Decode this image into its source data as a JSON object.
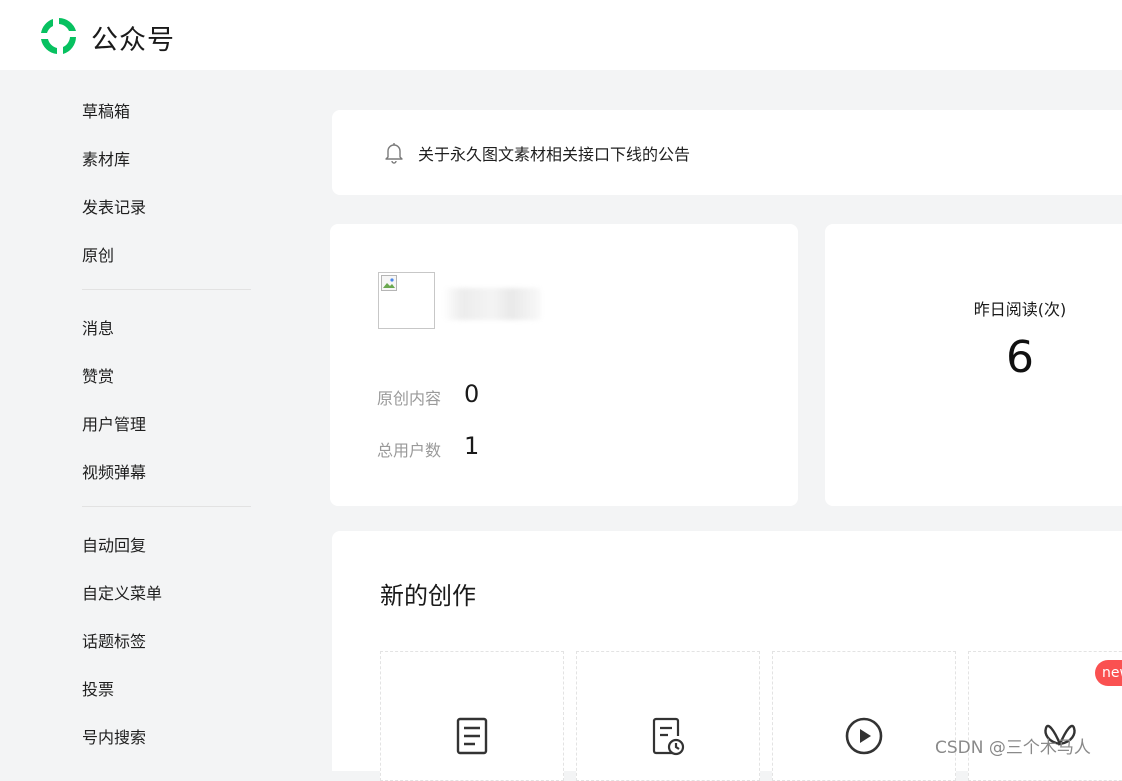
{
  "header": {
    "brand": "公众号",
    "logo_icon": "wechat-mp-logo-icon",
    "accent_color": "#07c160"
  },
  "sidebar": {
    "groups": [
      {
        "items": [
          {
            "label": "草稿箱"
          },
          {
            "label": "素材库"
          },
          {
            "label": "发表记录"
          },
          {
            "label": "原创"
          }
        ]
      },
      {
        "items": [
          {
            "label": "消息"
          },
          {
            "label": "赞赏"
          },
          {
            "label": "用户管理"
          },
          {
            "label": "视频弹幕"
          }
        ]
      },
      {
        "items": [
          {
            "label": "自动回复"
          },
          {
            "label": "自定义菜单"
          },
          {
            "label": "话题标签"
          },
          {
            "label": "投票"
          },
          {
            "label": "号内搜索"
          }
        ]
      }
    ]
  },
  "notice": {
    "icon": "bell-icon",
    "text": "关于永久图文素材相关接口下线的公告"
  },
  "account": {
    "stats": [
      {
        "label": "原创内容",
        "value": "0"
      },
      {
        "label": "总用户数",
        "value": "1"
      }
    ]
  },
  "reads": {
    "label": "昨日阅读(次)",
    "value": "6"
  },
  "create": {
    "title": "新的创作",
    "tiles": [
      {
        "icon": "article-icon"
      },
      {
        "icon": "scheduled-article-icon"
      },
      {
        "icon": "video-play-icon"
      },
      {
        "icon": "butterfly-icon",
        "badge": "new"
      }
    ],
    "badge_color": "#fa5151"
  },
  "watermark": "CSDN @三个木马人"
}
